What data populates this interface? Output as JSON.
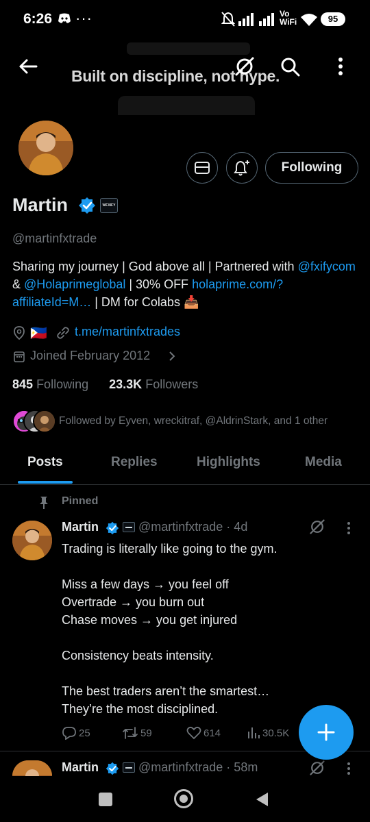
{
  "status_bar": {
    "time": "6:26",
    "dots": "···",
    "battery": "95",
    "network_label": "Vo WiFi"
  },
  "banner": {
    "text": "Built on discipline, not hype."
  },
  "profile": {
    "name": "Martin",
    "handle": "@martinfxtrade",
    "badge_label": "WFXIFY",
    "bio_part1": "Sharing my journey | God above all | Partnered with ",
    "bio_link1": "@fxifycom",
    "bio_part2": " & ",
    "bio_link2": "@Holaprimeglobal",
    "bio_part3": " | 30% OFF ",
    "bio_link3": "holaprime.com/?affiliateId=M…",
    "bio_part4": " | DM for Colabs 📥",
    "location_flag": "🇵🇭",
    "website": "t.me/martinfxtrades",
    "joined": "Joined February 2012",
    "following_count": "845",
    "following_label": "Following",
    "followers_count": "23.3K",
    "followers_label": "Followers",
    "followed_by": "Followed by Eyven, wreckitraf, @AldrinStark, and 1 other",
    "following_button": "Following"
  },
  "tabs": [
    {
      "label": "Posts"
    },
    {
      "label": "Replies"
    },
    {
      "label": "Highlights"
    },
    {
      "label": "Media"
    }
  ],
  "pinned_post": {
    "pinned_label": "Pinned",
    "name": "Martin",
    "handle_time": "@martinfxtrade · 4d",
    "text": "Trading is literally like going to the gym.\n\nMiss a few days → you feel off\nOvertrade → you burn out\nChase moves → you get injured\n\nConsistency beats intensity.\n\nThe best traders aren’t the smartest…\nThey’re the most disciplined.",
    "replies": "25",
    "reposts": "59",
    "likes": "614",
    "views": "30.5K"
  },
  "next_post": {
    "name": "Martin",
    "handle_time": "@martinfxtrade · 58m"
  },
  "colors": {
    "accent": "#1d9bf0",
    "background": "#000000",
    "text": "#e7e9ea",
    "muted": "#71767b"
  }
}
